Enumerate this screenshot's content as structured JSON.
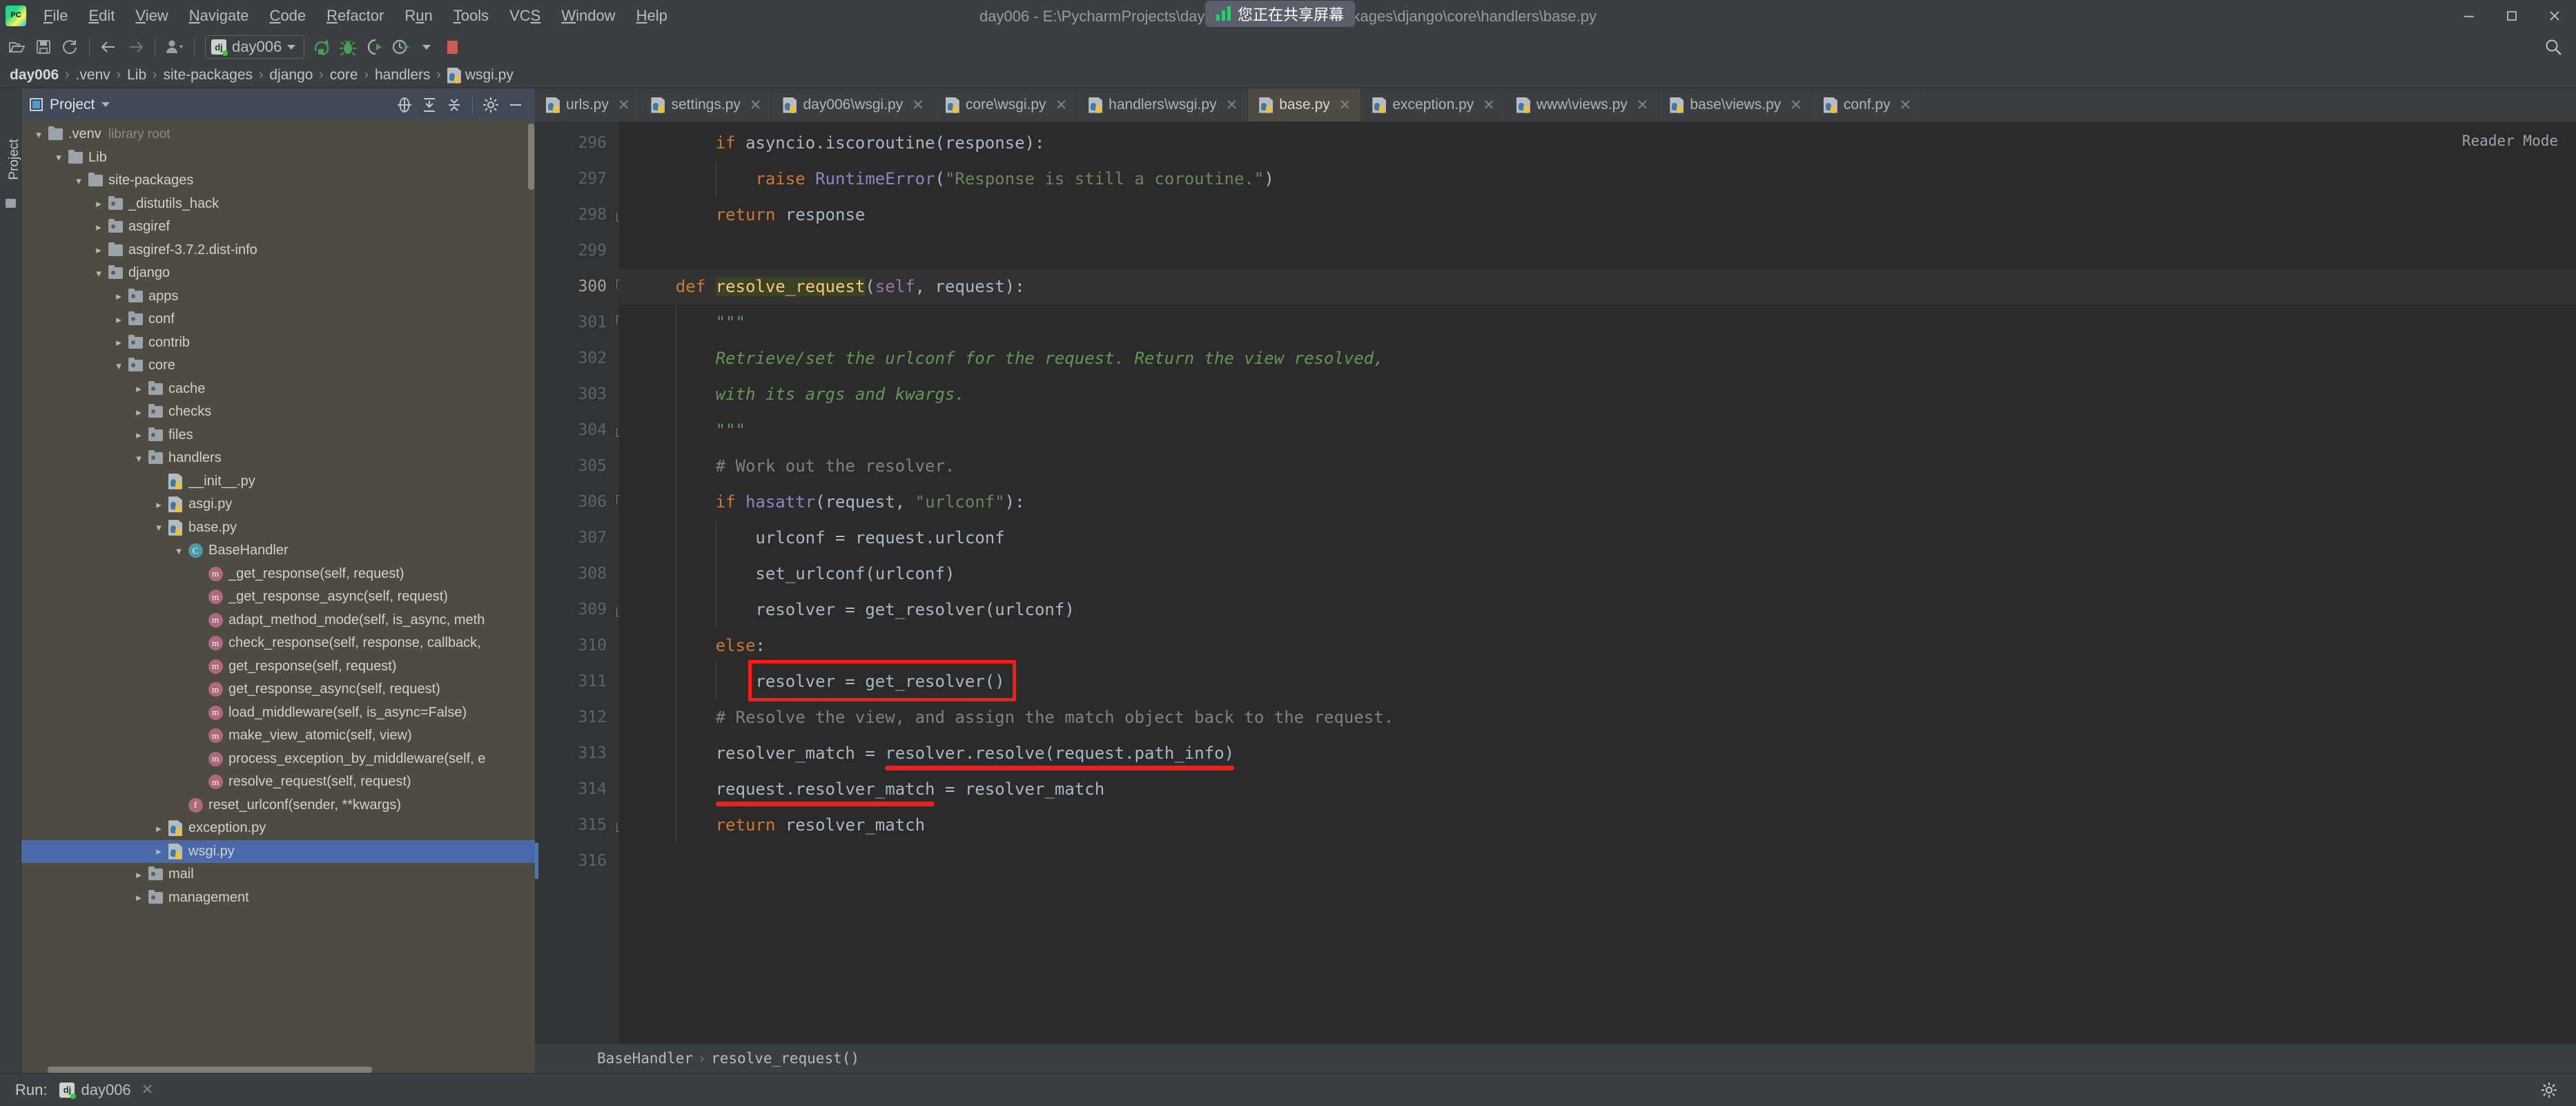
{
  "window": {
    "title": "day006 - E:\\PycharmProjects\\day006\\.venv\\Lib\\site-packages\\django\\core\\handlers\\base.py",
    "logo_text": "PC",
    "minimize": "—",
    "maximize": "❐",
    "close": "✕"
  },
  "share_toast": {
    "text": "您正在共享屏幕",
    "icon": "signal-bars-icon",
    "color": "#2ecc71"
  },
  "menu": {
    "items": [
      {
        "label": "File",
        "mnemonic": "F"
      },
      {
        "label": "Edit",
        "mnemonic": "E"
      },
      {
        "label": "View",
        "mnemonic": "V"
      },
      {
        "label": "Navigate",
        "mnemonic": "N"
      },
      {
        "label": "Code",
        "mnemonic": "C"
      },
      {
        "label": "Refactor",
        "mnemonic": "R"
      },
      {
        "label": "Run",
        "mnemonic": "u"
      },
      {
        "label": "Tools",
        "mnemonic": "T"
      },
      {
        "label": "VCS",
        "mnemonic": "S"
      },
      {
        "label": "Window",
        "mnemonic": "W"
      },
      {
        "label": "Help",
        "mnemonic": "H"
      }
    ]
  },
  "toolbar": {
    "open_icon": "open-folder-icon",
    "save_icon": "save-icon",
    "sync_icon": "refresh-icon",
    "back_icon": "arrow-left-icon",
    "forward_icon": "arrow-right-icon",
    "profile_icon": "user-profile-icon",
    "run_config_name": "day006",
    "run_config_badge": "dj",
    "run_icon": "run-icon",
    "debug_icon": "debug-bug-icon",
    "run_coverage_icon": "run-with-coverage-icon",
    "profiler_icon": "profiler-icon",
    "stop_icon": "stop-icon",
    "search_icon": "search-icon",
    "stop_color": "#cf5b56",
    "run_color": "#499c54"
  },
  "breadcrumb": {
    "items": [
      "day006",
      ".venv",
      "Lib",
      "site-packages",
      "django",
      "core",
      "handlers",
      "wsgi.py"
    ],
    "separator": "›"
  },
  "project_panel": {
    "title": "Project",
    "title_icon": "project-view-icon",
    "dropdown_icon": "chevron-down-icon",
    "actions": [
      {
        "name": "select-opened-file-icon"
      },
      {
        "name": "expand-all-icon"
      },
      {
        "name": "collapse-all-icon"
      },
      {
        "name": "gear-icon"
      },
      {
        "name": "hide-panel-icon"
      }
    ],
    "strip_label": "Project",
    "tree": [
      {
        "label": ".venv",
        "sub": "library root",
        "icon": "folder",
        "twist": "down",
        "indent": 0
      },
      {
        "label": "Lib",
        "sub": "",
        "icon": "folder",
        "twist": "down",
        "indent": 1
      },
      {
        "label": "site-packages",
        "sub": "",
        "icon": "folder",
        "twist": "down",
        "indent": 2
      },
      {
        "label": "_distutils_hack",
        "sub": "",
        "icon": "package",
        "twist": "right",
        "indent": 3
      },
      {
        "label": "asgiref",
        "sub": "",
        "icon": "package",
        "twist": "right",
        "indent": 3
      },
      {
        "label": "asgiref-3.7.2.dist-info",
        "sub": "",
        "icon": "folder",
        "twist": "right",
        "indent": 3
      },
      {
        "label": "django",
        "sub": "",
        "icon": "package",
        "twist": "down",
        "indent": 3
      },
      {
        "label": "apps",
        "sub": "",
        "icon": "package",
        "twist": "right",
        "indent": 4
      },
      {
        "label": "conf",
        "sub": "",
        "icon": "package",
        "twist": "right",
        "indent": 4
      },
      {
        "label": "contrib",
        "sub": "",
        "icon": "package",
        "twist": "right",
        "indent": 4
      },
      {
        "label": "core",
        "sub": "",
        "icon": "package",
        "twist": "down",
        "indent": 4
      },
      {
        "label": "cache",
        "sub": "",
        "icon": "package",
        "twist": "right",
        "indent": 5
      },
      {
        "label": "checks",
        "sub": "",
        "icon": "package",
        "twist": "right",
        "indent": 5
      },
      {
        "label": "files",
        "sub": "",
        "icon": "package",
        "twist": "right",
        "indent": 5
      },
      {
        "label": "handlers",
        "sub": "",
        "icon": "package",
        "twist": "down",
        "indent": 5
      },
      {
        "label": "__init__.py",
        "sub": "",
        "icon": "python",
        "twist": "none",
        "indent": 6
      },
      {
        "label": "asgi.py",
        "sub": "",
        "icon": "python",
        "twist": "right",
        "indent": 6
      },
      {
        "label": "base.py",
        "sub": "",
        "icon": "python",
        "twist": "down",
        "indent": 6
      },
      {
        "label": "BaseHandler",
        "sub": "",
        "icon": "class",
        "twist": "down",
        "indent": 7
      },
      {
        "label": "_get_response(self, request)",
        "sub": "",
        "icon": "method",
        "twist": "none",
        "indent": 8
      },
      {
        "label": "_get_response_async(self, request)",
        "sub": "",
        "icon": "method",
        "twist": "none",
        "indent": 8
      },
      {
        "label": "adapt_method_mode(self, is_async, meth",
        "sub": "",
        "icon": "method",
        "twist": "none",
        "indent": 8
      },
      {
        "label": "check_response(self, response, callback,",
        "sub": "",
        "icon": "method",
        "twist": "none",
        "indent": 8
      },
      {
        "label": "get_response(self, request)",
        "sub": "",
        "icon": "method",
        "twist": "none",
        "indent": 8
      },
      {
        "label": "get_response_async(self, request)",
        "sub": "",
        "icon": "method",
        "twist": "none",
        "indent": 8
      },
      {
        "label": "load_middleware(self, is_async=False)",
        "sub": "",
        "icon": "method",
        "twist": "none",
        "indent": 8
      },
      {
        "label": "make_view_atomic(self, view)",
        "sub": "",
        "icon": "method",
        "twist": "none",
        "indent": 8
      },
      {
        "label": "process_exception_by_middleware(self, e",
        "sub": "",
        "icon": "method",
        "twist": "none",
        "indent": 8
      },
      {
        "label": "resolve_request(self, request)",
        "sub": "",
        "icon": "method",
        "twist": "none",
        "indent": 8
      },
      {
        "label": "reset_urlconf(sender, **kwargs)",
        "sub": "",
        "icon": "function",
        "twist": "none",
        "indent": 7
      },
      {
        "label": "exception.py",
        "sub": "",
        "icon": "python",
        "twist": "right",
        "indent": 6
      },
      {
        "label": "wsgi.py",
        "sub": "",
        "icon": "python",
        "twist": "right",
        "indent": 6,
        "selected": true
      },
      {
        "label": "mail",
        "sub": "",
        "icon": "package",
        "twist": "right",
        "indent": 5
      },
      {
        "label": "management",
        "sub": "",
        "icon": "package",
        "twist": "right",
        "indent": 5
      }
    ]
  },
  "editor": {
    "tabs": [
      {
        "label": "urls.py",
        "active": false
      },
      {
        "label": "settings.py",
        "active": false
      },
      {
        "label": "day006\\wsgi.py",
        "active": false
      },
      {
        "label": "core\\wsgi.py",
        "active": false
      },
      {
        "label": "handlers\\wsgi.py",
        "active": false
      },
      {
        "label": "base.py",
        "active": true
      },
      {
        "label": "exception.py",
        "active": false
      },
      {
        "label": "www\\views.py",
        "active": false
      },
      {
        "label": "base\\views.py",
        "active": false
      },
      {
        "label": "conf.py",
        "active": false
      }
    ],
    "close_icon": "✕",
    "reader_mode": "Reader Mode",
    "first_line": 296,
    "lines": [
      {
        "n": 296,
        "fold": "",
        "text": "        if asyncio.iscoroutine(response):"
      },
      {
        "n": 297,
        "fold": "",
        "text": "            raise RuntimeError(\"Response is still a coroutine.\")"
      },
      {
        "n": 298,
        "fold": "up",
        "text": "        return response"
      },
      {
        "n": 299,
        "fold": "",
        "text": ""
      },
      {
        "n": 300,
        "fold": "down",
        "text": "    def resolve_request(self, request):"
      },
      {
        "n": 301,
        "fold": "down",
        "text": "        \"\"\""
      },
      {
        "n": 302,
        "fold": "",
        "text": "        Retrieve/set the urlconf for the request. Return the view resolved,"
      },
      {
        "n": 303,
        "fold": "",
        "text": "        with its args and kwargs."
      },
      {
        "n": 304,
        "fold": "up",
        "text": "        \"\"\""
      },
      {
        "n": 305,
        "fold": "",
        "text": "        # Work out the resolver."
      },
      {
        "n": 306,
        "fold": "down",
        "text": "        if hasattr(request, \"urlconf\"):"
      },
      {
        "n": 307,
        "fold": "",
        "text": "            urlconf = request.urlconf"
      },
      {
        "n": 308,
        "fold": "",
        "text": "            set_urlconf(urlconf)"
      },
      {
        "n": 309,
        "fold": "up",
        "text": "            resolver = get_resolver(urlconf)"
      },
      {
        "n": 310,
        "fold": "",
        "text": "        else:"
      },
      {
        "n": 311,
        "fold": "",
        "text": "            resolver = get_resolver()"
      },
      {
        "n": 312,
        "fold": "",
        "text": "        # Resolve the view, and assign the match object back to the request."
      },
      {
        "n": 313,
        "fold": "",
        "text": "        resolver_match = resolver.resolve(request.path_info)"
      },
      {
        "n": 314,
        "fold": "",
        "text": "        request.resolver_match = resolver_match"
      },
      {
        "n": 315,
        "fold": "up",
        "text": "        return resolver_match"
      },
      {
        "n": 316,
        "fold": "",
        "text": ""
      }
    ],
    "annotations": [
      {
        "kind": "box",
        "target": "resolver = get_resolver()",
        "line": 311,
        "color": "#ff1a1a"
      },
      {
        "kind": "underline",
        "target": "resolver.resolve(request.path_info)",
        "line": 313,
        "color": "#ff1a1a"
      },
      {
        "kind": "underline",
        "target": "request.resolver_match",
        "line": 314,
        "color": "#ff1a1a"
      }
    ],
    "code_breadcrumb": {
      "items": [
        "BaseHandler",
        "resolve_request()"
      ],
      "separator": "›"
    }
  },
  "run_bar": {
    "label": "Run:",
    "config_name": "day006",
    "config_badge": "dj",
    "close_icon": "✕",
    "gear_icon": "gear-icon"
  }
}
